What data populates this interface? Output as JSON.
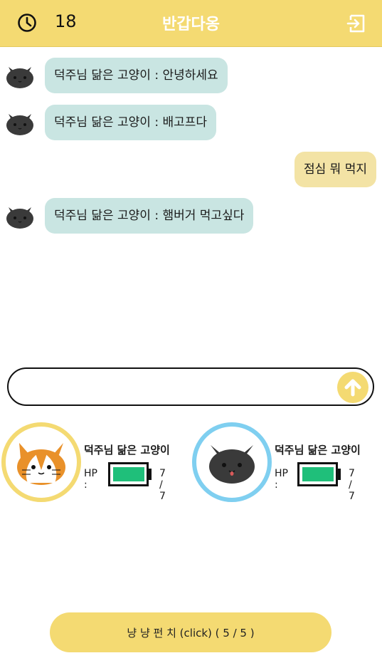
{
  "header": {
    "timer_icon": "clock-icon",
    "timer_value": "18",
    "title": "반갑다옹",
    "exit_icon": "exit-icon"
  },
  "chat": {
    "messages": [
      {
        "side": "left",
        "avatar": "black-cat-icon",
        "text": "덕주님 닮은 고양이 : 안녕하세요"
      },
      {
        "side": "left",
        "avatar": "black-cat-icon",
        "text": "덕주님 닮은 고양이 : 배고프다"
      },
      {
        "side": "right",
        "text": "점심 뭐 먹지"
      },
      {
        "side": "left",
        "avatar": "black-cat-icon",
        "text": "덕주님 닮은 고양이 : 햄버거 먹고싶다"
      }
    ]
  },
  "input": {
    "value": "",
    "placeholder": "",
    "send_icon": "arrow-up-icon"
  },
  "players": [
    {
      "name": "덕주님 닮은 고양이",
      "avatar": "orange-cat-icon",
      "ring_color": "#f4da72",
      "hp_label": "HP :",
      "hp_text": "7 / 7",
      "hp_fraction": 1.0
    },
    {
      "name": "덕주님 닮은 고양이",
      "avatar": "black-cat-icon",
      "ring_color": "#7fcff0",
      "hp_label": "HP :",
      "hp_text": "7 / 7",
      "hp_fraction": 1.0
    }
  ],
  "action": {
    "label": "냥 냥 펀 치 (click) ( 5 / 5 )"
  },
  "colors": {
    "accent": "#f4da72",
    "bubble_left": "#c9e5e2",
    "bubble_right": "#f3e3a5",
    "hp_fill": "#1fbf7a",
    "opponent_ring": "#7fcff0"
  }
}
